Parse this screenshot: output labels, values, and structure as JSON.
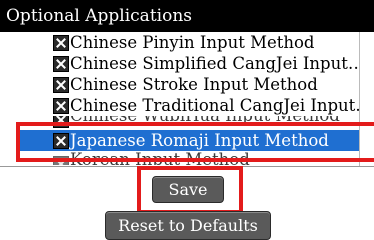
{
  "title": "Optional Applications",
  "items": [
    {
      "label": "Chinese Pinyin Input Method",
      "checked": true
    },
    {
      "label": "Chinese Simplified CangJei Input…",
      "checked": true
    },
    {
      "label": "Chinese Stroke Input Method",
      "checked": true
    },
    {
      "label": "Chinese Traditional CangJei Input…",
      "checked": true
    },
    {
      "label": "Chinese WubiHua Input Method",
      "checked": true
    },
    {
      "label": "Japanese Romaji Input Method",
      "checked": true,
      "selected": true
    },
    {
      "label": "Korean Input Method",
      "checked": false
    }
  ],
  "buttons": {
    "save": "Save",
    "reset": "Reset to Defaults"
  },
  "colors": {
    "titlebar": "#000000",
    "selection": "#1f6fd1",
    "highlight": "#e31b1b",
    "button": "#5a5a5a"
  }
}
